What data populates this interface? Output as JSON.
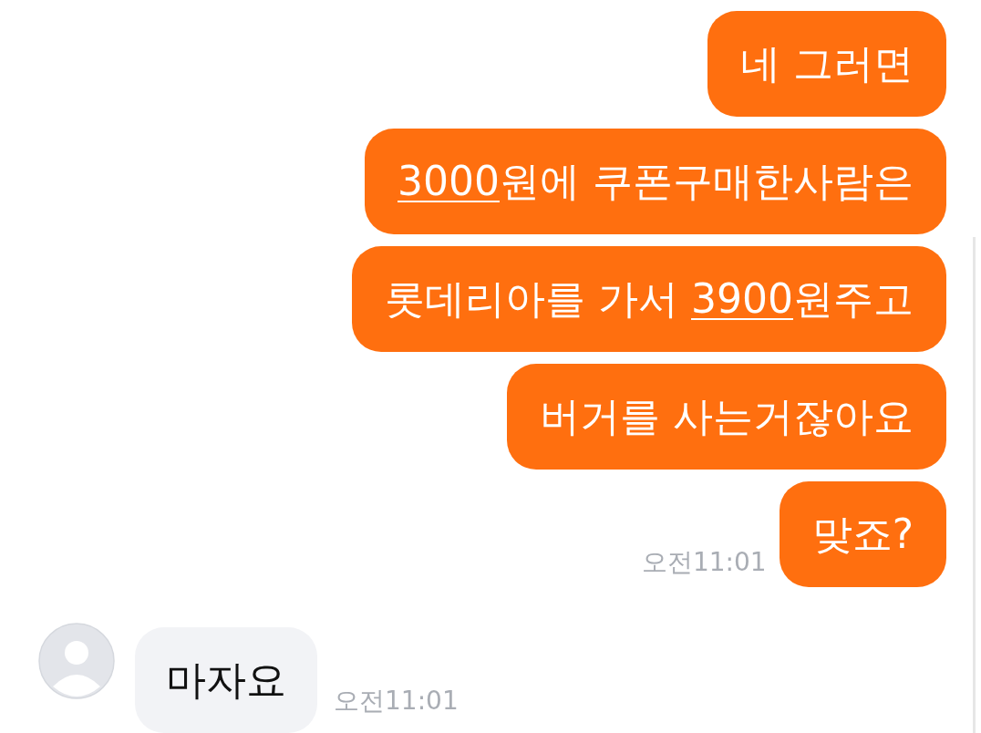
{
  "messages": [
    {
      "kind": "sent",
      "parts": [
        {
          "text": "네 그러면",
          "underline": false
        }
      ]
    },
    {
      "kind": "sent",
      "parts": [
        {
          "text": "3000",
          "underline": true
        },
        {
          "text": "원에 쿠폰구매한사람은",
          "underline": false
        }
      ]
    },
    {
      "kind": "sent",
      "parts": [
        {
          "text": "롯데리아를 가서 ",
          "underline": false
        },
        {
          "text": "3900",
          "underline": true
        },
        {
          "text": "원주고",
          "underline": false
        }
      ]
    },
    {
      "kind": "sent",
      "parts": [
        {
          "text": "버거를 사는거잖아요",
          "underline": false
        }
      ]
    },
    {
      "kind": "sent",
      "parts": [
        {
          "text": "맞죠?",
          "underline": false
        }
      ],
      "time": "오전11:01"
    },
    {
      "kind": "received",
      "parts": [
        {
          "text": "마자요",
          "underline": false
        }
      ],
      "time": "오전11:01"
    }
  ]
}
